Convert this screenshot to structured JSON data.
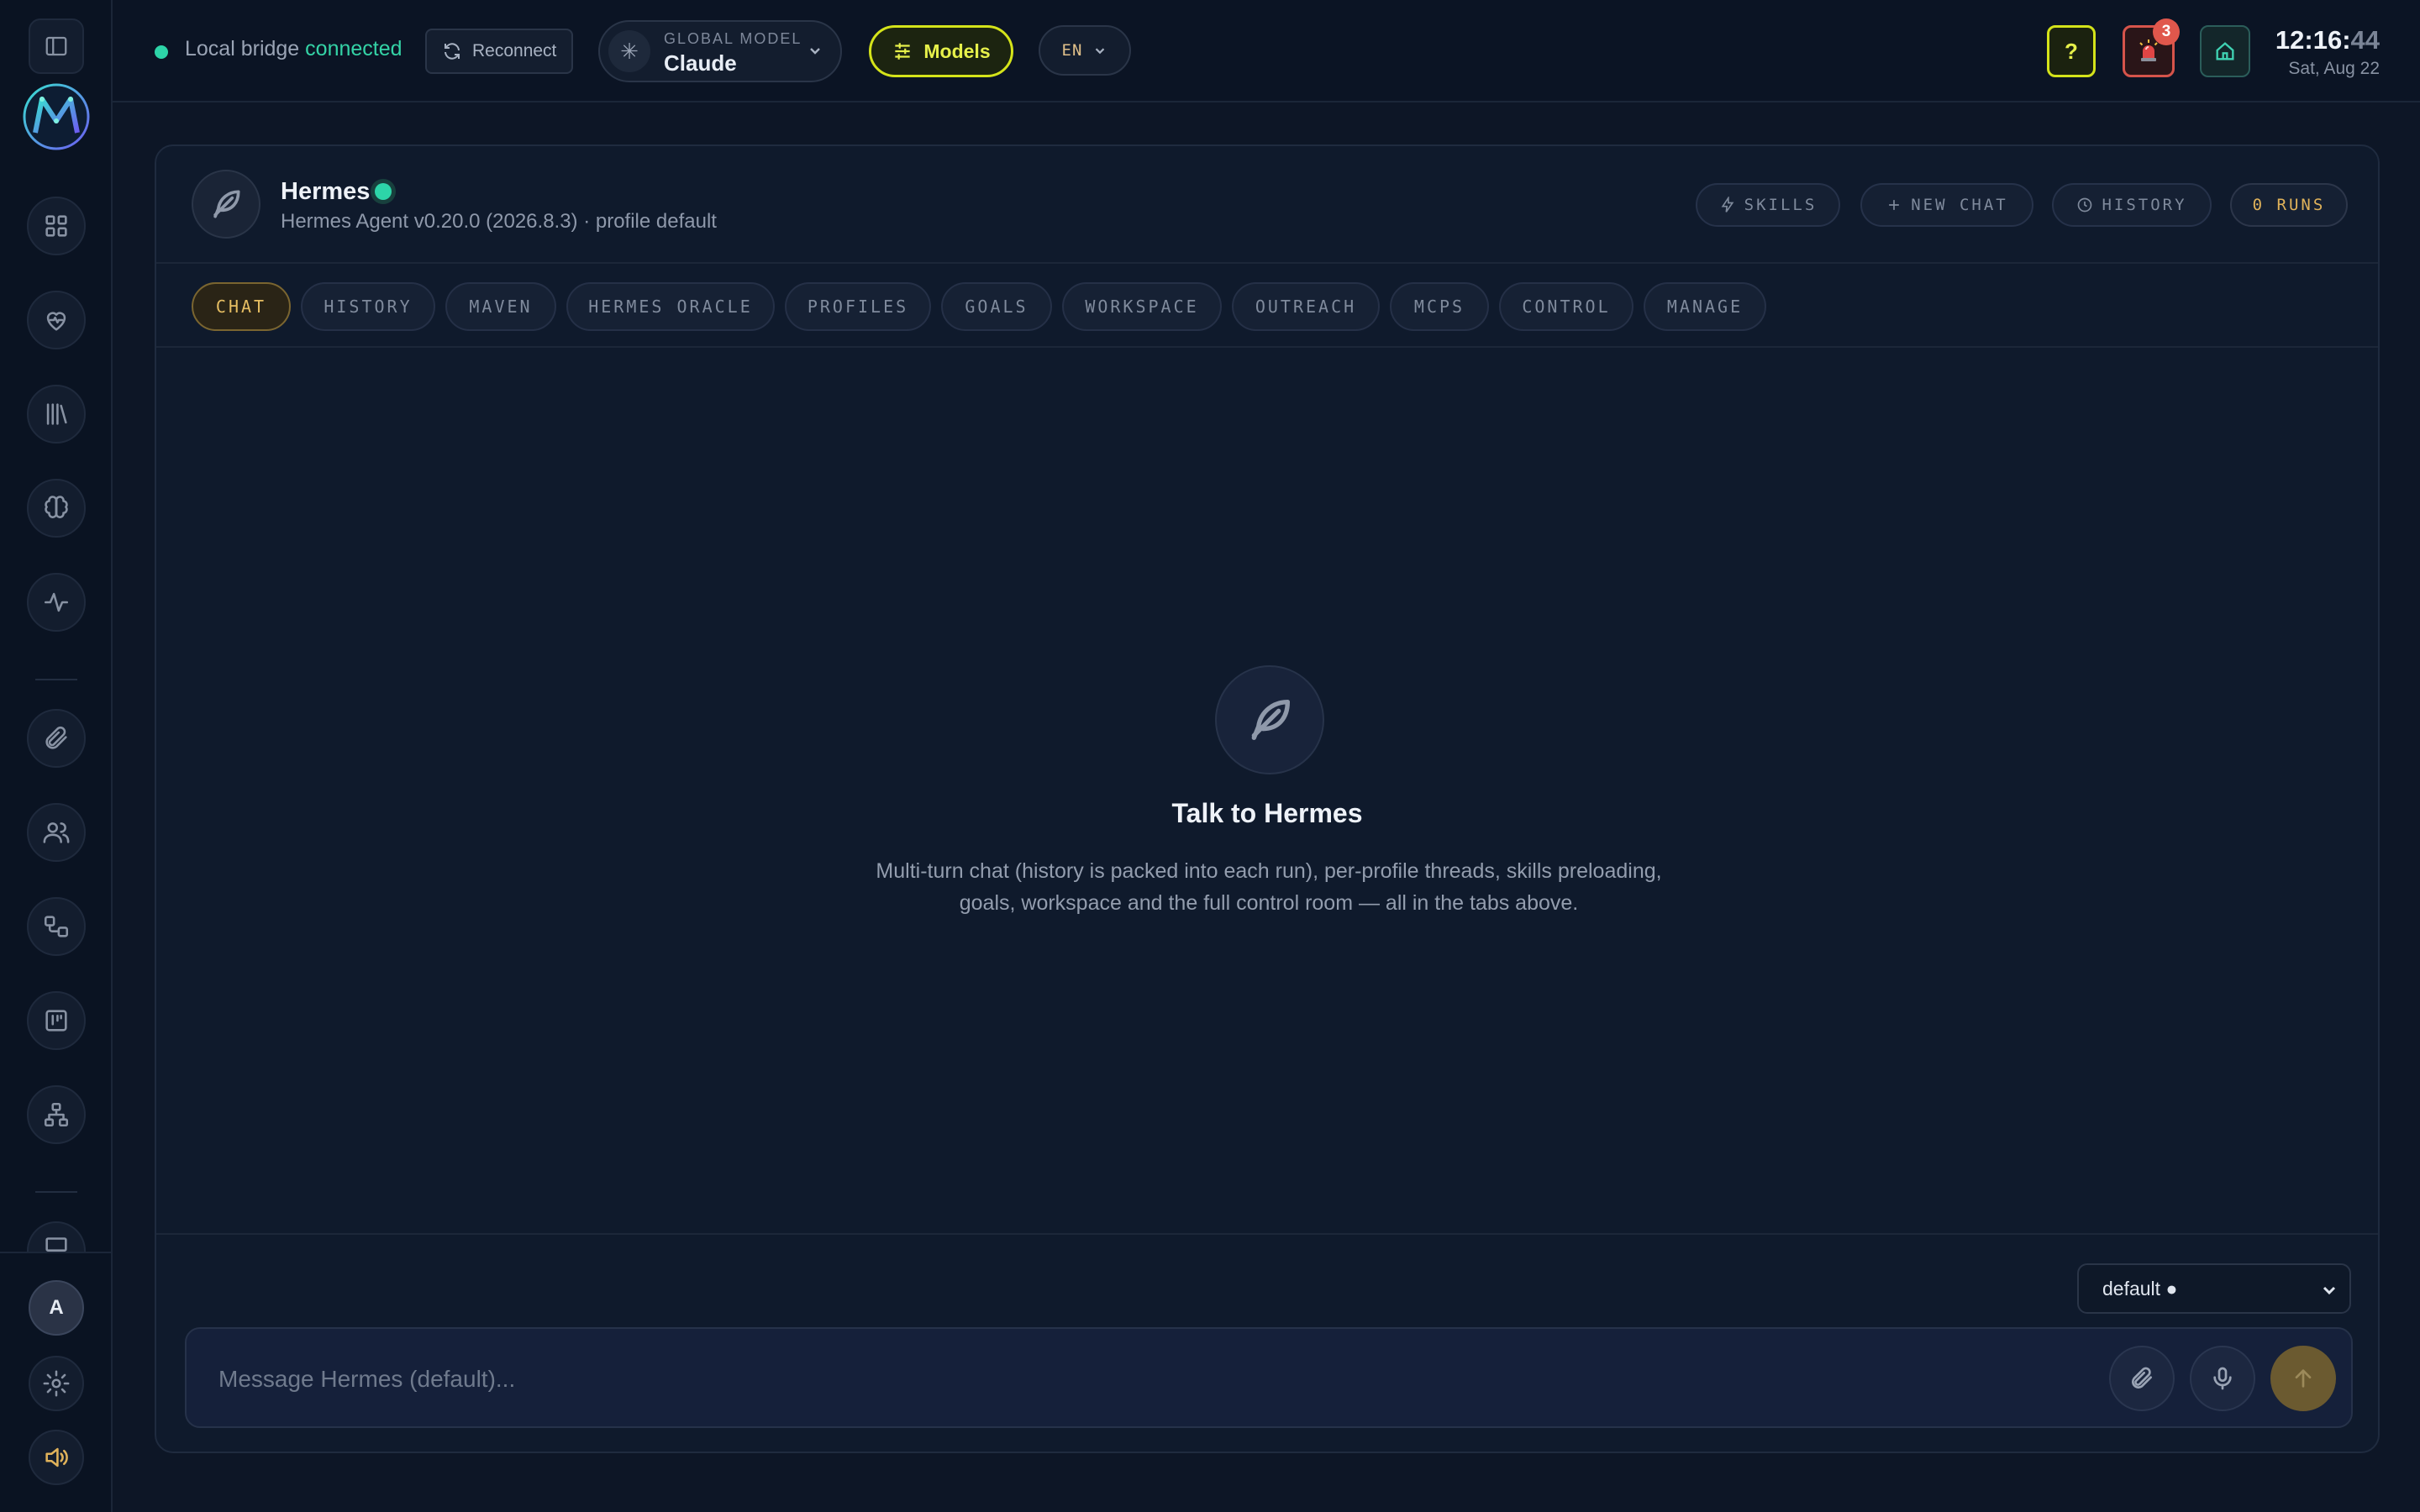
{
  "topbar": {
    "bridge_label": "Local bridge",
    "bridge_status": "connected",
    "reconnect_label": "Reconnect",
    "model_caption": "GLOBAL MODEL",
    "model_value": "Claude",
    "models_label": "Models",
    "language": "EN",
    "help_label": "?",
    "alert_count": "3",
    "time_hm": "12:16:",
    "time_s": "44",
    "date": "Sat, Aug 22"
  },
  "sidebar": {
    "avatar_letter": "A",
    "icons": [
      "panel-toggle-icon",
      "dashboard-icon",
      "health-icon",
      "library-icon",
      "brain-icon",
      "activity-icon",
      "paperclip-icon",
      "users-icon",
      "workflow-icon",
      "board-icon",
      "org-chart-icon",
      "monitor-icon",
      "settings-icon",
      "volume-icon"
    ]
  },
  "agent": {
    "name": "Hermes",
    "subtitle": "Hermes Agent v0.20.0 (2026.8.3) · profile default",
    "skills_label": "SKILLS",
    "new_chat_label": "NEW CHAT",
    "history_label": "HISTORY",
    "runs_label": "0 RUNS"
  },
  "tabs": [
    "CHAT",
    "HISTORY",
    "MAVEN",
    "HERMES ORACLE",
    "PROFILES",
    "GOALS",
    "WORKSPACE",
    "OUTREACH",
    "MCPS",
    "CONTROL",
    "MANAGE"
  ],
  "active_tab": "CHAT",
  "empty_state": {
    "title": "Talk to Hermes",
    "description": "Multi-turn chat (history is packed into each run), per-profile threads, skills preloading, goals, workspace and the full control room — all in the tabs above."
  },
  "composer": {
    "profile_selected": "default ●",
    "placeholder": "Message Hermes (default)..."
  },
  "colors": {
    "accent_yellow": "#d4e31a",
    "status_green": "#2dd4a8",
    "alert_red": "#e0574c",
    "active_tab_gold": "#e6be62"
  }
}
